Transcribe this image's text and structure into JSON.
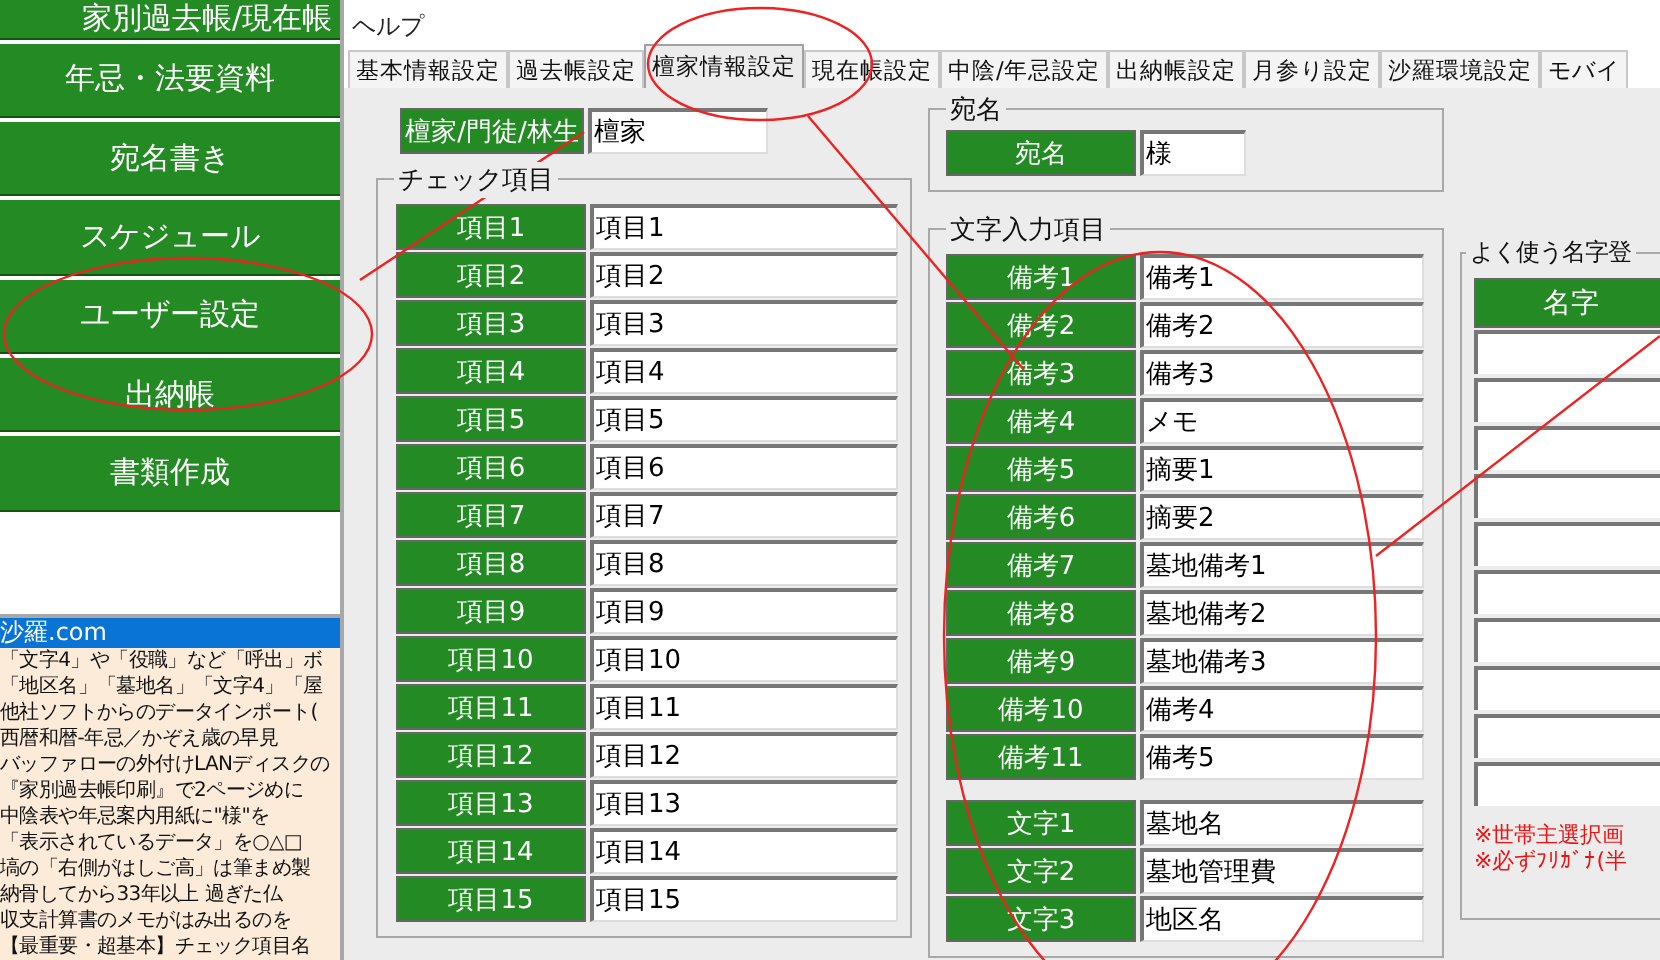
{
  "sidebar": {
    "items": [
      {
        "label": "家別過去帳/現在帳"
      },
      {
        "label": "年忌・法要資料"
      },
      {
        "label": "宛名書き"
      },
      {
        "label": "スケジュール"
      },
      {
        "label": "ユーザー設定"
      },
      {
        "label": "出納帳"
      },
      {
        "label": "書類作成"
      }
    ]
  },
  "help": {
    "title": "沙羅.com",
    "items": [
      "「文字4」や「役職」など「呼出」ボ",
      "「地区名」「墓地名」「文字4」「屋",
      "他社ソフトからのデータインポート(",
      "西暦和暦-年忌／かぞえ歳の早見",
      "バッファローの外付けLANディスクの",
      "『家別過去帳印刷』で2ページめに",
      "中陰表や年忌案内用紙に\"様\"を",
      "「表示されているデータ」を○△□",
      "塙の「右側がはしご高」は筆まめ製",
      "納骨してから33年以上 過ぎた仏",
      "収支計算書のメモがはみ出るのを",
      "【最重要・超基本】チェック項目名"
    ]
  },
  "menu": {
    "items": [
      "ヘルプ"
    ]
  },
  "tabs": [
    {
      "label": "基本情報設定",
      "selected": false
    },
    {
      "label": "過去帳設定",
      "selected": false
    },
    {
      "label": "檀家情報設定",
      "selected": true
    },
    {
      "label": "現在帳設定",
      "selected": false
    },
    {
      "label": "中陰/年忌設定",
      "selected": false
    },
    {
      "label": "出納帳設定",
      "selected": false
    },
    {
      "label": "月参り設定",
      "selected": false
    },
    {
      "label": "沙羅環境設定",
      "selected": false
    },
    {
      "label": "モバイ",
      "selected": false
    }
  ],
  "danka": {
    "label": "檀家/門徒/林生",
    "value": "檀家"
  },
  "check_items": {
    "title": "チェック項目",
    "rows": [
      {
        "label": "項目1",
        "value": "項目1"
      },
      {
        "label": "項目2",
        "value": "項目2"
      },
      {
        "label": "項目3",
        "value": "項目3"
      },
      {
        "label": "項目4",
        "value": "項目4"
      },
      {
        "label": "項目5",
        "value": "項目5"
      },
      {
        "label": "項目6",
        "value": "項目6"
      },
      {
        "label": "項目7",
        "value": "項目7"
      },
      {
        "label": "項目8",
        "value": "項目8"
      },
      {
        "label": "項目9",
        "value": "項目9"
      },
      {
        "label": "項目10",
        "value": "項目10"
      },
      {
        "label": "項目11",
        "value": "項目11"
      },
      {
        "label": "項目12",
        "value": "項目12"
      },
      {
        "label": "項目13",
        "value": "項目13"
      },
      {
        "label": "項目14",
        "value": "項目14"
      },
      {
        "label": "項目15",
        "value": "項目15"
      }
    ]
  },
  "atena": {
    "title": "宛名",
    "label": "宛名",
    "value": "様"
  },
  "text_items": {
    "title": "文字入力項目",
    "groups": [
      {
        "rows": [
          {
            "label": "備考1",
            "value": "備考1"
          },
          {
            "label": "備考2",
            "value": "備考2"
          },
          {
            "label": "備考3",
            "value": "備考3"
          },
          {
            "label": "備考4",
            "value": "メモ"
          },
          {
            "label": "備考5",
            "value": "摘要1"
          },
          {
            "label": "備考6",
            "value": "摘要2"
          },
          {
            "label": "備考7",
            "value": "墓地備考1"
          },
          {
            "label": "備考8",
            "value": "墓地備考2"
          },
          {
            "label": "備考9",
            "value": "墓地備考3"
          },
          {
            "label": "備考10",
            "value": "備考4"
          },
          {
            "label": "備考11",
            "value": "備考5"
          }
        ]
      },
      {
        "rows": [
          {
            "label": "文字1",
            "value": "墓地名"
          },
          {
            "label": "文字2",
            "value": "墓地管理費"
          },
          {
            "label": "文字3",
            "value": "地区名"
          }
        ]
      }
    ]
  },
  "surnames": {
    "title": "よく使う名字登",
    "header": "名字",
    "notes": [
      "※世帯主選択画",
      "※必ずﾌﾘｶﾞﾅ(半"
    ]
  }
}
